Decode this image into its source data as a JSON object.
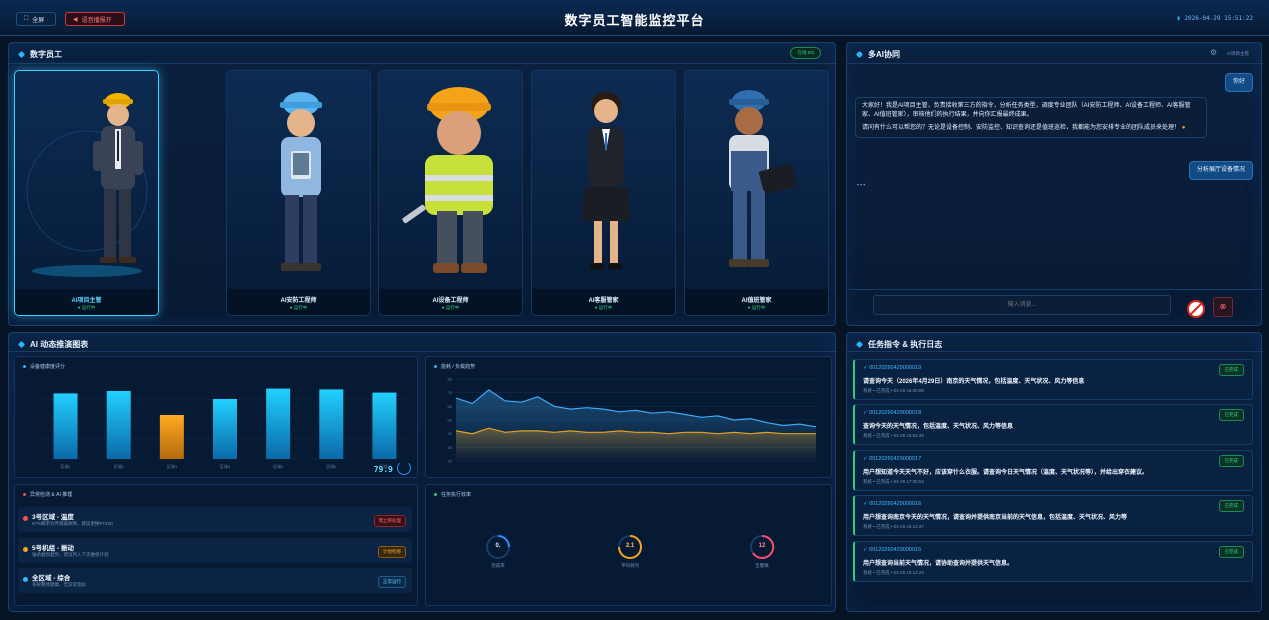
{
  "header": {
    "title": "数字员工智能监控平台",
    "fullscreen_label": "全屏",
    "alarm_label": "语音播报开",
    "datetime": "2026-04-29 15:51:22"
  },
  "employees_panel": {
    "title": "数字员工",
    "online_badge": "在线 5/5",
    "cards": [
      {
        "name": "AI项目主管",
        "status": "● 运行中"
      },
      {
        "name": "AI安防工程师",
        "status": "● 运行中"
      },
      {
        "name": "AI设备工程师",
        "status": "● 运行中"
      },
      {
        "name": "AI客服管家",
        "status": "● 运行中"
      },
      {
        "name": "AI值班管家",
        "status": "● 运行中"
      }
    ]
  },
  "chat_panel": {
    "title": "多AI协同",
    "right_label": "AI项目主管",
    "user_msg_1": "你好",
    "assistant_msg_p1": "大家好！我是AI项目主管，负责接收第三方的指令，分析任务类型，调度专业团队（AI安防工程师、AI设备工程师、AI客服管家、AI值班管家），审核他们的执行结果，并向你汇报最终成果。",
    "assistant_msg_p2": "请问有什么可以帮您的？无论是设备控制、安防监控、知识查询还是值班巡检，我都能为您安排专业的团队成员来处理！",
    "user_msg_2": "分析展厅设备情况",
    "input_placeholder": "输入消息..."
  },
  "chart_panel": {
    "title": "AI 动态推演图表",
    "bar_title": "设备健康度评分",
    "bar_readout": "79.9",
    "line_title": "能耗 / 负载趋势",
    "alerts_title": "异常检测 & AI 推理",
    "efficiency_title": "任务执行效率"
  },
  "chart_data": [
    {
      "type": "bar",
      "title": "设备健康度评分",
      "categories": [
        "区域1",
        "区域2",
        "区域3",
        "区域4",
        "区域5",
        "区域6",
        "区域7"
      ],
      "values": [
        82,
        85,
        55,
        75,
        88,
        87,
        83
      ],
      "colors": [
        "#1fc7f5",
        "#1fc7f5",
        "#f5a21f",
        "#1fc7f5",
        "#1fc7f5",
        "#1fc7f5",
        "#1fc7f5"
      ],
      "ylim": [
        0,
        100
      ],
      "grid": true
    },
    {
      "type": "line",
      "title": "能耗 / 负载趋势",
      "ylabels": [
        "80",
        "70",
        "60",
        "50",
        "40",
        "30",
        "20"
      ],
      "ylim": [
        20,
        80
      ],
      "series": [
        {
          "color": "#3fa9f5",
          "values": [
            66,
            62,
            72,
            64,
            63,
            67,
            60,
            58,
            59,
            58,
            56,
            57,
            55,
            56,
            54,
            52,
            53,
            50,
            51,
            48,
            46,
            47,
            45
          ]
        },
        {
          "color": "#e8a020",
          "values": [
            42,
            40,
            44,
            41,
            42,
            42,
            41,
            42,
            41,
            41,
            42,
            41,
            41,
            40,
            41,
            41,
            40,
            41,
            40,
            41,
            40,
            40,
            40
          ]
        }
      ]
    }
  ],
  "alerts": [
    {
      "title": "3号区域 - 温度",
      "desc": "97%概率为传感器故障，建议更换PT100",
      "badge": "需立即处理",
      "color": "#ff4d4d"
    },
    {
      "title": "5号机组 - 振动",
      "desc": "轴承磨损趋势，建议列入下次维保计划",
      "badge": "计划检修",
      "color": "#f5a21f"
    },
    {
      "title": "全区域 - 综合",
      "desc": "系统整体健康，无异常指标",
      "badge": "正常运行",
      "color": "#2fb8ff"
    }
  ],
  "efficiency": [
    {
      "value": "0.",
      "label": "完成率",
      "color": "#2f8bff"
    },
    {
      "value": "2.1",
      "label": "平均耗时",
      "color": "#f5a21f"
    },
    {
      "value": "12",
      "label": "告警数",
      "color": "#ff4d6a"
    }
  ],
  "logs_panel": {
    "title": "任务指令 & 执行日志",
    "items": [
      {
        "id": "✓ 00120260429000019",
        "text": "请查询今天（2026年4月29日）南京的天气情况，包括温度、天气状况、风力等信息",
        "meta": "系统  •  已完成  •  04-29 16:00:08",
        "badge": "已完成"
      },
      {
        "id": "✓ 00120260429000018",
        "text": "查询今天的天气情况，包括温度、天气状况、风力等信息",
        "meta": "系统  •  已完成  •  04-29 15:52:46",
        "badge": "已完成"
      },
      {
        "id": "✓ 00120260429000017",
        "text": "用户想知道今天天气不好，应该穿什么衣服。请查询今日天气情况（温度、天气状况等），并给出穿衣建议。",
        "meta": "系统  •  已完成  •  04-29 17:30:04",
        "badge": "已完成"
      },
      {
        "id": "✓ 00120260429000016",
        "text": "用户想查询南京今天的天气情况，请查询并提供南京当前的天气信息，包括温度、天气状况、风力等",
        "meta": "系统  •  已完成  •  04-29 15:12:47",
        "badge": "已完成"
      },
      {
        "id": "✓ 00120260429000015",
        "text": "用户想查询当前天气情况，请协助查询并提供天气信息。",
        "meta": "系统  •  已完成  •  04-29 15:12:22",
        "badge": "已完成"
      }
    ]
  }
}
